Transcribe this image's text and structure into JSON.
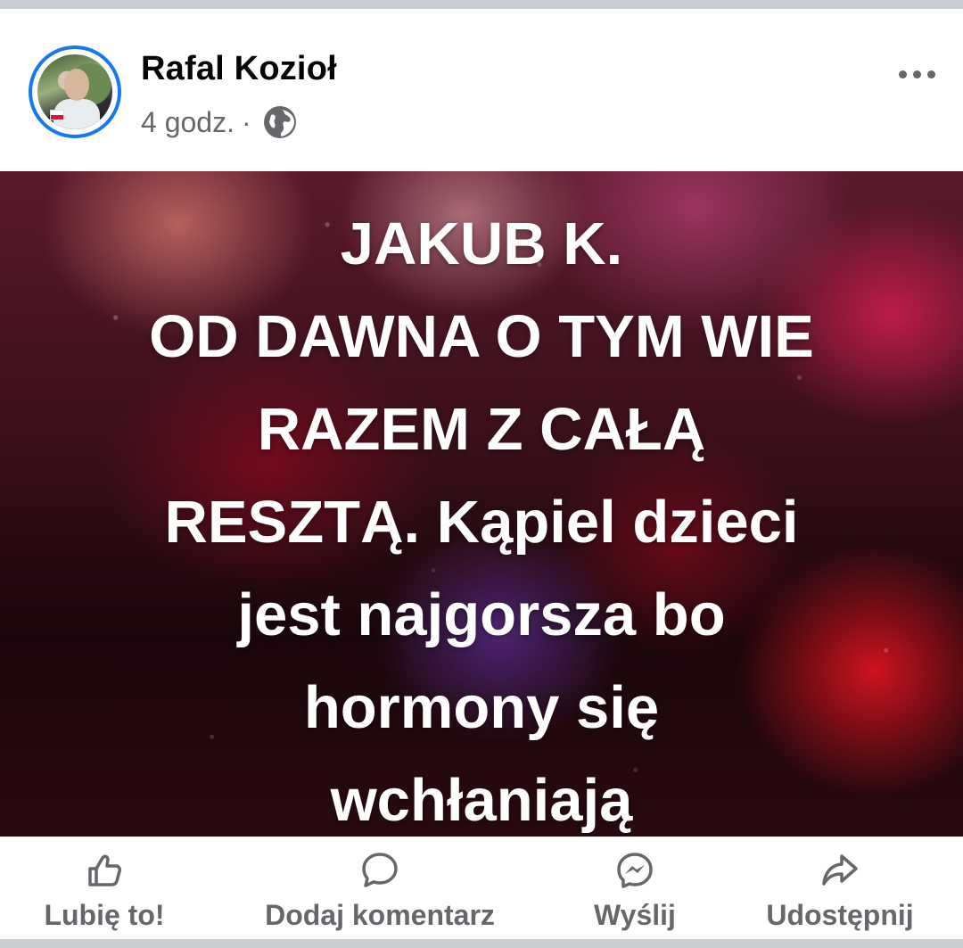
{
  "post": {
    "author": "Rafal Kozioł",
    "timestamp": "4 godz.",
    "separator": "·",
    "audience_icon": "globe-icon",
    "more_icon": "more-dots-icon",
    "text_lines": [
      "JAKUB K.",
      "OD DAWNA O TYM WIE",
      "RAZEM Z CAŁĄ",
      "RESZTĄ. Kąpiel dzieci",
      "jest najgorsza bo",
      "hormony się",
      "wchłaniają"
    ]
  },
  "actions": {
    "like": "Lubię to!",
    "comment": "Dodaj komentarz",
    "send": "Wyślij",
    "share": "Udostępnij"
  },
  "colors": {
    "accent": "#1877f2",
    "secondary_text": "#65676b",
    "divider": "#c9ccd1"
  }
}
